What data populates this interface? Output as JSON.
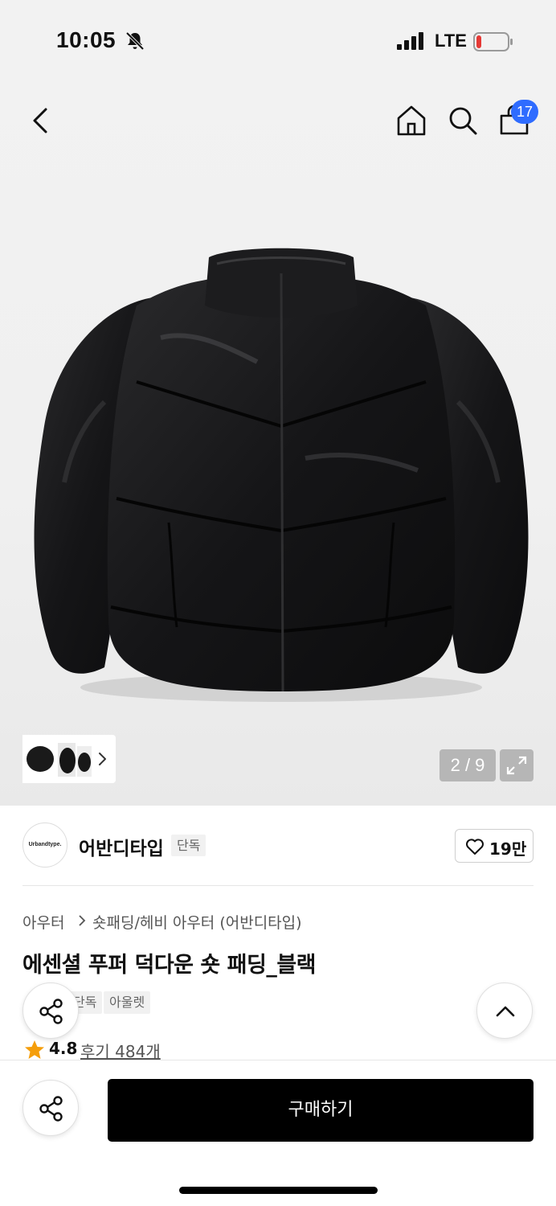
{
  "status_bar": {
    "time": "10:05",
    "network": "LTE",
    "battery_color": "#e53935"
  },
  "nav": {
    "cart_count": "17",
    "badge_color": "#2f6cff"
  },
  "gallery": {
    "counter": "2 / 9"
  },
  "store": {
    "logo_text": "Urbandtype.",
    "name": "어반디타입",
    "exclusive_label": "단독",
    "likes": "19만"
  },
  "breadcrumb": {
    "category": "아우터",
    "subcategory": "숏패딩/헤비 아우터 (어반디타입)"
  },
  "product": {
    "title": "에센셜 푸퍼 덕다운 숏 패딩_블랙",
    "tags": [
      "단독",
      "아울렛"
    ],
    "rating": "4.8",
    "reviews": "후기 484개",
    "rating_color": "#f59e0b"
  },
  "bottom": {
    "buy_label": "구매하기"
  }
}
